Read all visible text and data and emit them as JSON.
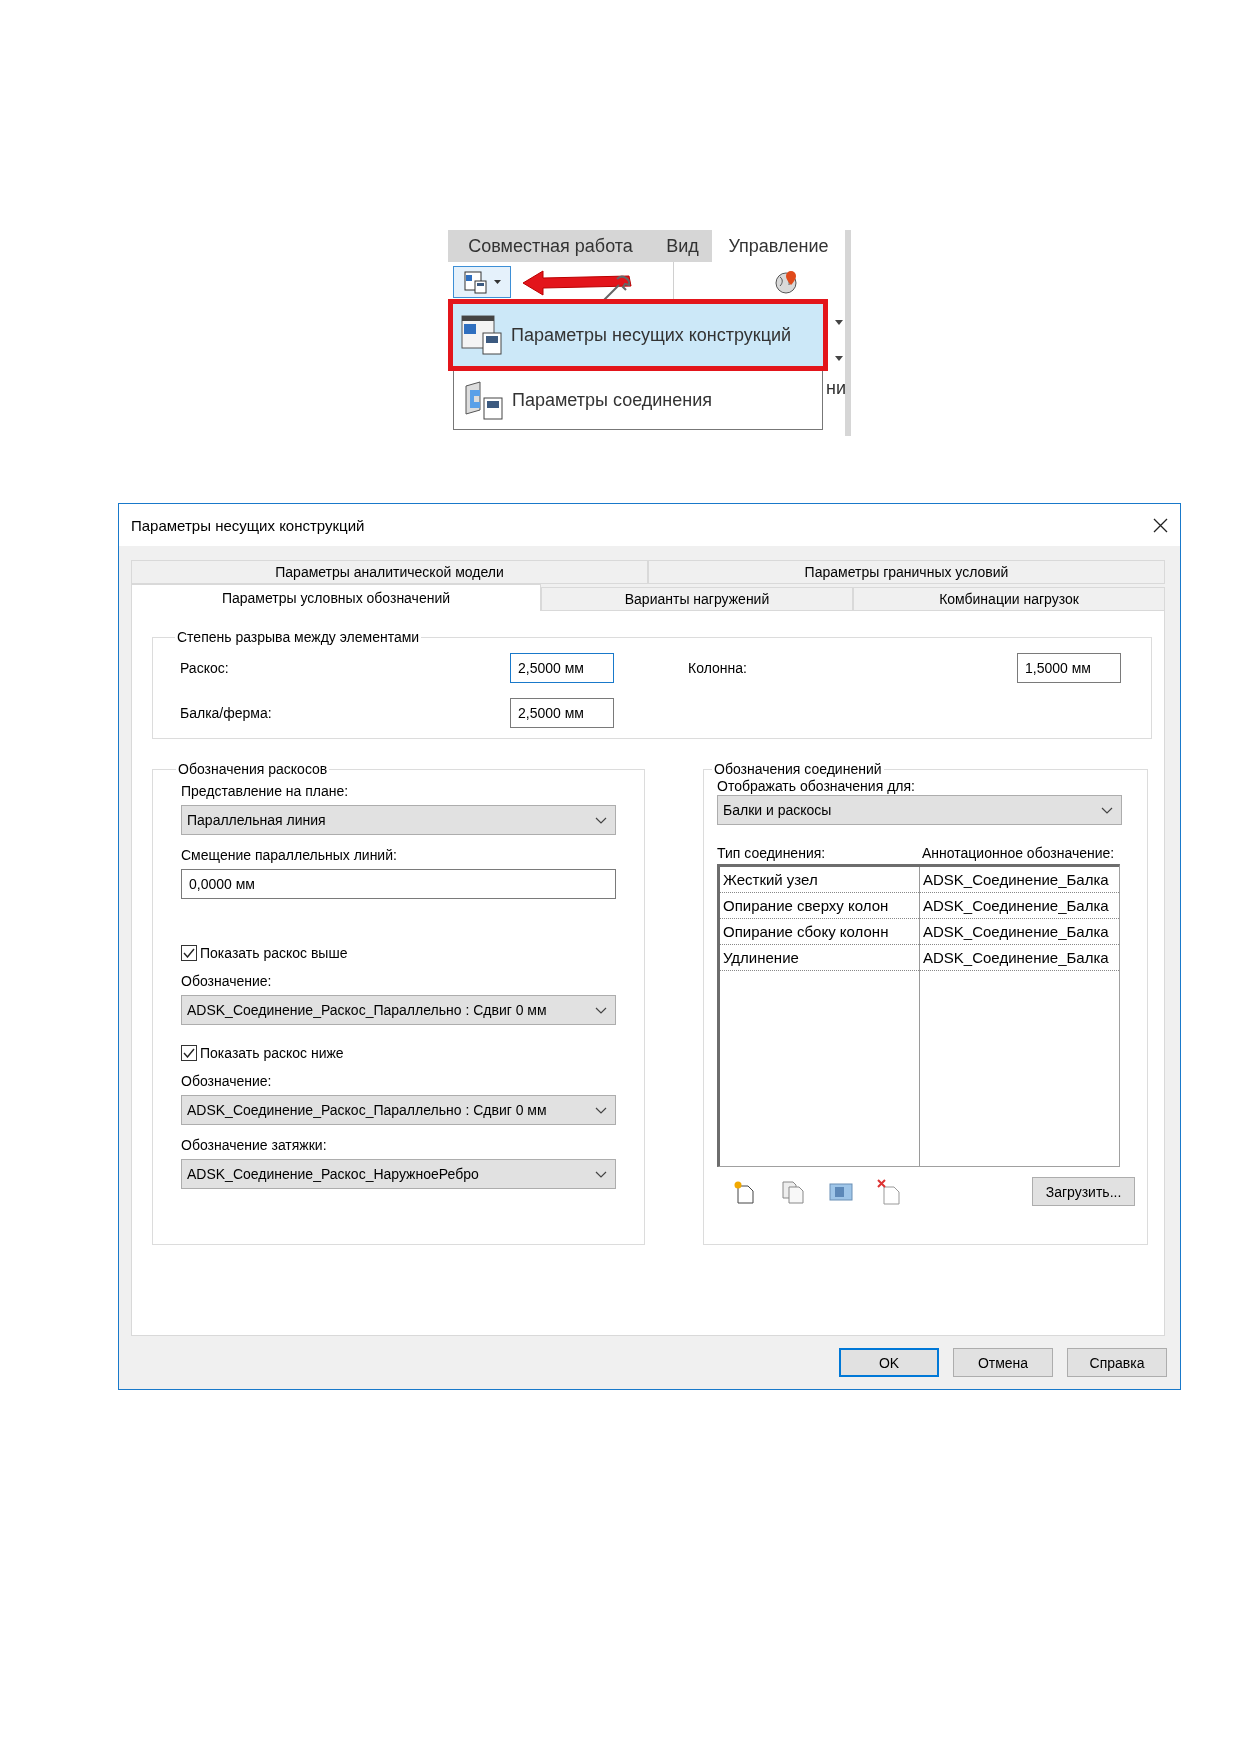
{
  "ribbon": {
    "tabs": [
      {
        "label": "Совместная работа",
        "selected": false
      },
      {
        "label": "Вид",
        "selected": false
      },
      {
        "label": "Управление",
        "selected": true
      }
    ],
    "menu": [
      {
        "label": "Параметры несущих конструкций",
        "selected": true
      },
      {
        "label": "Параметры  соединения",
        "selected": false
      }
    ],
    "partial_label": "ни"
  },
  "dialog": {
    "title": "Параметры несущих конструкций",
    "tab_rows": [
      [
        {
          "label": "Параметры аналитической модели",
          "selected": false
        },
        {
          "label": "Параметры граничных условий",
          "selected": false
        }
      ],
      [
        {
          "label": "Параметры условных обозначений",
          "selected": true
        },
        {
          "label": "Варианты нагружений",
          "selected": false
        },
        {
          "label": "Комбинации нагрузок",
          "selected": false
        }
      ]
    ],
    "gap_group": {
      "title": "Степень разрыва между элементами",
      "fields": [
        {
          "label": "Раскос:",
          "value": "2,5000 мм",
          "focused": true
        },
        {
          "label": "Колонна:",
          "value": "1,5000 мм",
          "focused": false
        },
        {
          "label": "Балка/ферма:",
          "value": "2,5000 мм",
          "focused": false
        }
      ]
    },
    "brace_group": {
      "title": "Обозначения раскосов",
      "items": [
        {
          "kind": "label",
          "text": "Представление на плане:"
        },
        {
          "kind": "select",
          "value": "Параллельная линия"
        },
        {
          "kind": "label",
          "text": "Смещение параллельных линий:"
        },
        {
          "kind": "input",
          "value": "0,0000 мм"
        },
        {
          "kind": "checkbox",
          "text": "Показать раскос выше",
          "checked": true
        },
        {
          "kind": "label",
          "text": "Обозначение:"
        },
        {
          "kind": "select",
          "value": "ADSK_Соединение_Раскос_Параллельно : Сдвиг 0 мм"
        },
        {
          "kind": "checkbox",
          "text": "Показать раскос ниже",
          "checked": true
        },
        {
          "kind": "label",
          "text": "Обозначение:"
        },
        {
          "kind": "select",
          "value": "ADSK_Соединение_Раскос_Параллельно : Сдвиг 0 мм"
        },
        {
          "kind": "label",
          "text": "Обозначение затяжки:"
        },
        {
          "kind": "select",
          "value": "ADSK_Соединение_Раскос_НаружноеРебро"
        }
      ]
    },
    "connection_group": {
      "title": "Обозначения соединений",
      "show_label": "Отображать обозначения для:",
      "show_value": "Балки и раскосы",
      "columns": [
        "Тип соединения:",
        "Аннотационное обозначение:"
      ],
      "rows": [
        [
          "Жесткий узел",
          "ADSK_Соединение_Балка"
        ],
        [
          "Опирание сверху колон",
          "ADSK_Соединение_Балка"
        ],
        [
          "Опирание сбоку колонн",
          "ADSK_Соединение_Балка"
        ],
        [
          "Удлинение",
          "ADSK_Соединение_Балка"
        ]
      ],
      "load_button": "Загрузить..."
    },
    "buttons": [
      {
        "label": "OK",
        "default": true
      },
      {
        "label": "Отмена",
        "default": false
      },
      {
        "label": "Справка",
        "default": false
      }
    ]
  }
}
